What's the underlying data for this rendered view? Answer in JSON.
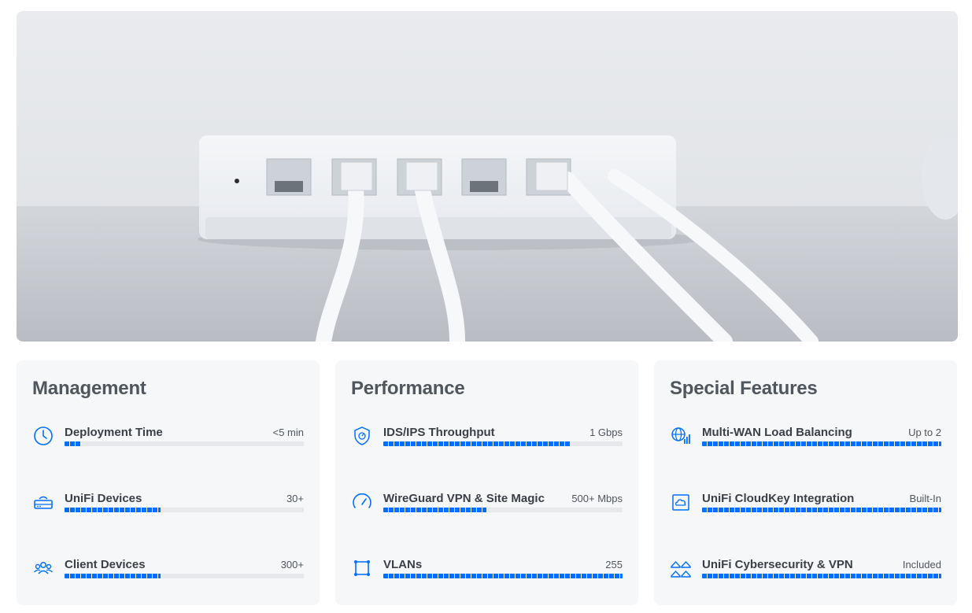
{
  "colors": {
    "accent": "#006fff",
    "card_bg": "#f6f7f8",
    "track": "#e6e8eb"
  },
  "hero": {
    "image": "white-router-with-cables-photo"
  },
  "cards": [
    {
      "title": "Management",
      "items": [
        {
          "label": "Deployment Time",
          "value": "<5 min",
          "level": 0.07,
          "icon": "clock-icon"
        },
        {
          "label": "UniFi Devices",
          "value": "30+",
          "level": 0.4,
          "icon": "device-icon"
        },
        {
          "label": "Client Devices",
          "value": "300+",
          "level": 0.4,
          "icon": "users-icon"
        }
      ]
    },
    {
      "title": "Performance",
      "items": [
        {
          "label": "IDS/IPS Throughput",
          "value": "1 Gbps",
          "level": 0.78,
          "icon": "shield-icon"
        },
        {
          "label": "WireGuard VPN & Site Magic",
          "value": "500+ Mbps",
          "level": 0.43,
          "icon": "gauge-icon"
        },
        {
          "label": "VLANs",
          "value": "255",
          "level": 1.0,
          "icon": "vlan-icon"
        }
      ]
    },
    {
      "title": "Special Features",
      "items": [
        {
          "label": "Multi-WAN Load Balancing",
          "value": "Up to 2",
          "level": 1.0,
          "icon": "globe-signal-icon"
        },
        {
          "label": "UniFi CloudKey Integration",
          "value": "Built-In",
          "level": 1.0,
          "icon": "cloudkey-icon"
        },
        {
          "label": "UniFi Cybersecurity & VPN",
          "value": "Included",
          "level": 1.0,
          "icon": "cybersecurity-icon"
        }
      ]
    }
  ]
}
